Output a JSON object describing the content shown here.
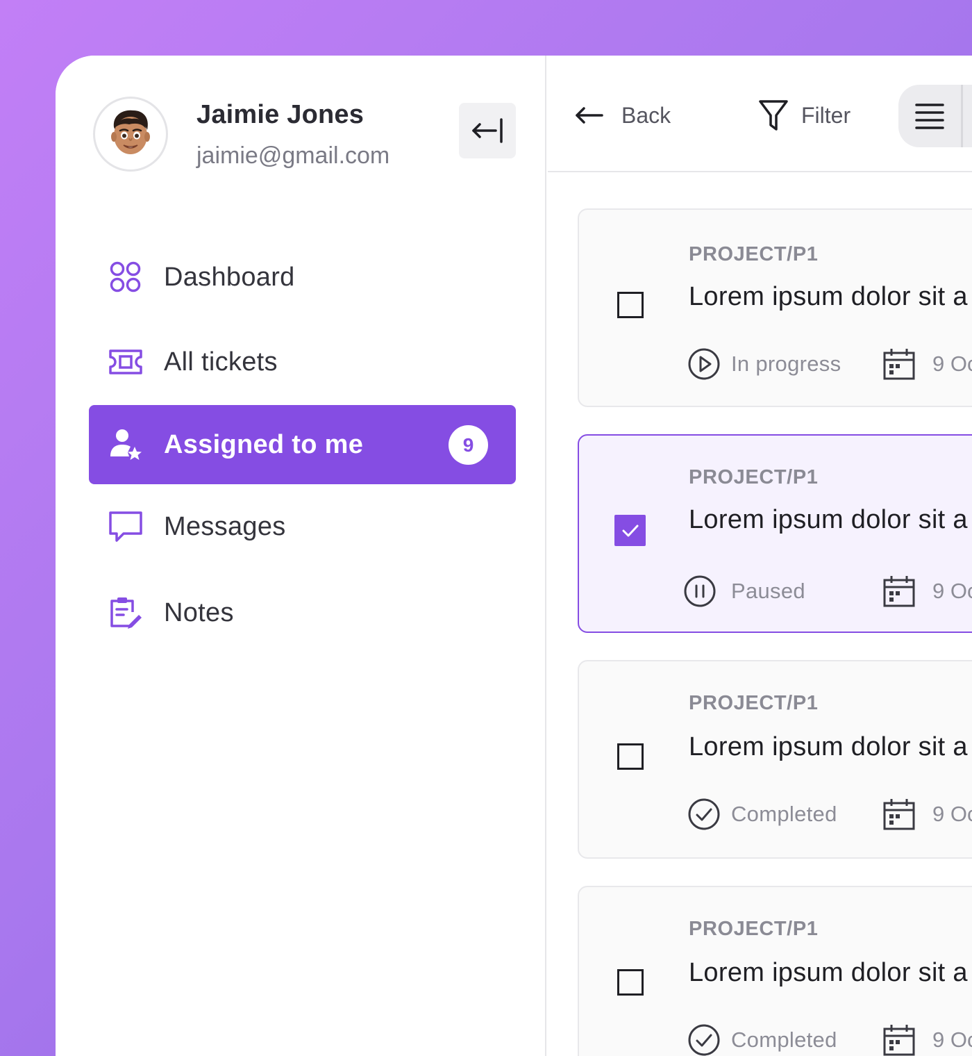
{
  "user": {
    "name": "Jaimie Jones",
    "email": "jaimie@gmail.com"
  },
  "sidebar": {
    "collapse_icon": "collapse-left-icon",
    "items": [
      {
        "label": "Dashboard",
        "icon": "dashboard-grid-icon",
        "active": false
      },
      {
        "label": "All tickets",
        "icon": "ticket-icon",
        "active": false
      },
      {
        "label": "Assigned to me",
        "icon": "user-star-icon",
        "active": true,
        "badge": "9"
      },
      {
        "label": "Messages",
        "icon": "message-icon",
        "active": false
      },
      {
        "label": "Notes",
        "icon": "notes-icon",
        "active": false
      }
    ]
  },
  "toolbar": {
    "back_label": "Back",
    "filter_label": "Filter",
    "view_icon": "list-view-icon"
  },
  "tickets": [
    {
      "project": "PROJECT/P1",
      "title": "Lorem ipsum dolor sit a",
      "status": "In progress",
      "status_icon": "play-circle-icon",
      "date": "9 Oc",
      "checked": false
    },
    {
      "project": "PROJECT/P1",
      "title": "Lorem ipsum dolor sit a",
      "status": "Paused",
      "status_icon": "pause-circle-icon",
      "date": "9 Oc",
      "checked": true
    },
    {
      "project": "PROJECT/P1",
      "title": "Lorem ipsum dolor sit a",
      "status": "Completed",
      "status_icon": "check-circle-icon",
      "date": "9 Oc",
      "checked": false
    },
    {
      "project": "PROJECT/P1",
      "title": "Lorem ipsum dolor sit a",
      "status": "Completed",
      "status_icon": "check-circle-icon",
      "date": "9 Oc",
      "checked": false
    }
  ],
  "colors": {
    "accent": "#854de3",
    "background_gradient_start": "#c27ff6",
    "background_gradient_end": "#8a63e3",
    "selected_card_bg": "#f6f2fe"
  }
}
